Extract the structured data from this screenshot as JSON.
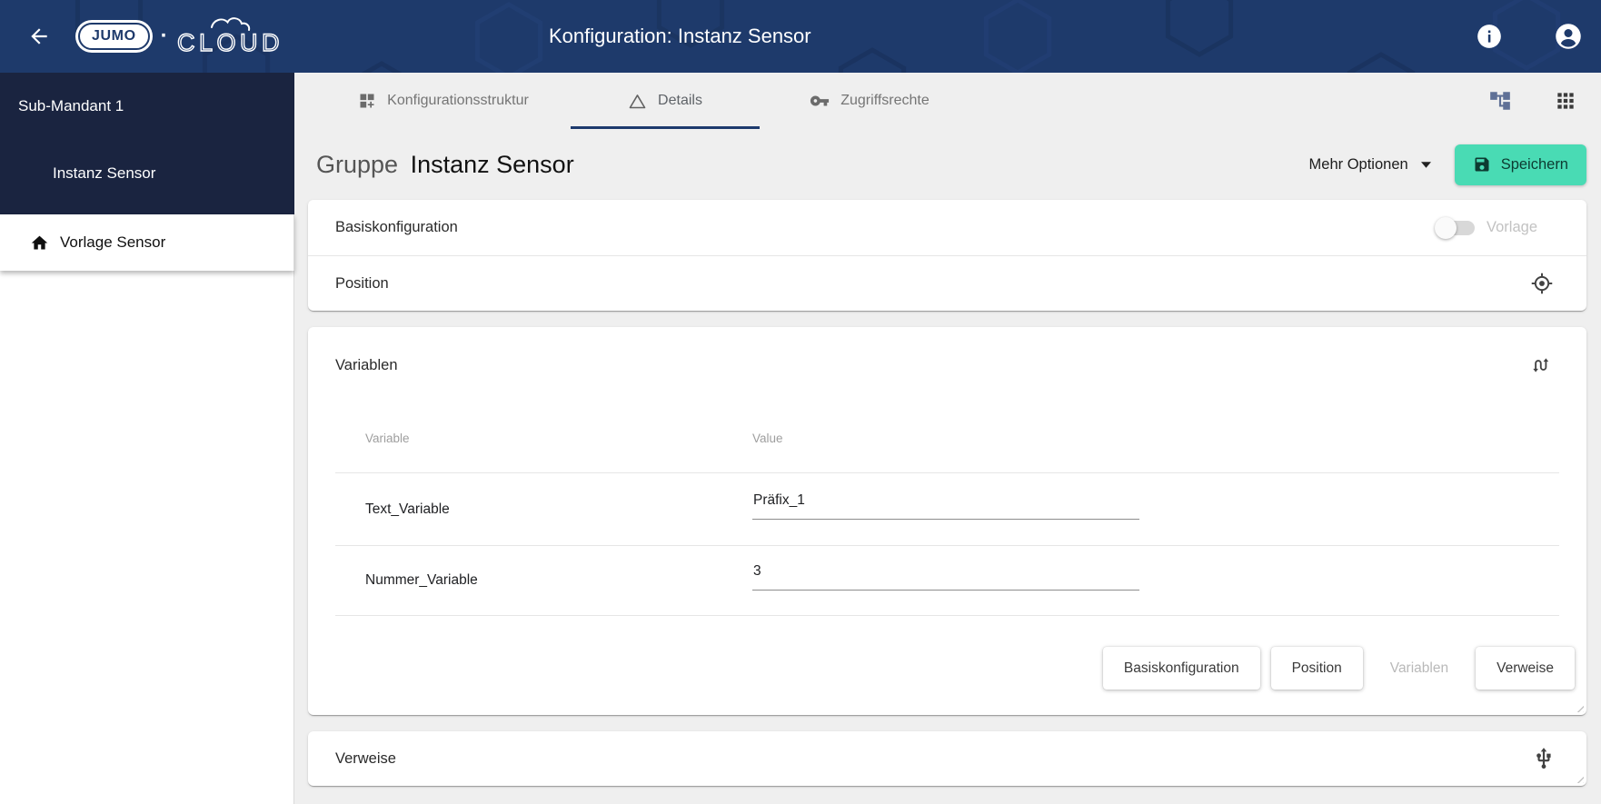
{
  "header": {
    "brand_jumo": "JUMO",
    "brand_dot": "·",
    "brand_cloud": "CLOUD",
    "title": "Konfiguration: Instanz Sensor",
    "icons": [
      "back-arrow-icon",
      "info-icon",
      "account-icon"
    ]
  },
  "sidebar": {
    "tenant": "Sub-Mandant 1",
    "instance_item": "Instanz Sensor",
    "template_item": "Vorlage Sensor",
    "template_icon": "home-icon"
  },
  "tabs": {
    "items": [
      {
        "label": "Konfigurationsstruktur",
        "icon": "dashboard-customize-icon",
        "active": false
      },
      {
        "label": "Details",
        "icon": "details-triangle-icon",
        "active": true
      },
      {
        "label": "Zugriffsrechte",
        "icon": "key-icon",
        "active": false
      }
    ],
    "right_icons": [
      "tree-structure-icon",
      "apps-grid-icon"
    ]
  },
  "toolbar": {
    "heading_prefix": "Gruppe",
    "heading_name": "Instanz Sensor",
    "more_options_label": "Mehr Optionen",
    "save_label": "Speichern",
    "save_icon": "save-icon",
    "caret_icon": "caret-down-icon"
  },
  "sections": {
    "basiskonfiguration": {
      "label": "Basiskonfiguration",
      "toggle_label": "Vorlage",
      "toggle_state": "off"
    },
    "position": {
      "label": "Position",
      "icon": "position-target-icon"
    },
    "variablen": {
      "label": "Variablen",
      "icon": "sort-swap-icon",
      "columns": {
        "variable": "Variable",
        "value": "Value"
      },
      "rows": [
        {
          "variable": "Text_Variable",
          "value": "Präfix_1"
        },
        {
          "variable": "Nummer_Variable",
          "value": "3"
        }
      ],
      "footer_buttons": [
        {
          "label": "Basiskonfiguration",
          "disabled": false
        },
        {
          "label": "Position",
          "disabled": false
        },
        {
          "label": "Variablen",
          "disabled": true
        },
        {
          "label": "Verweise",
          "disabled": false
        }
      ]
    },
    "verweise": {
      "label": "Verweise",
      "icon": "usb-icon"
    }
  },
  "colors": {
    "topbar": "#1e3a6b",
    "sidebar": "#1a2440",
    "accent_save": "#49dbb4",
    "active_tab_underline": "#1d3a6d",
    "page_background": "#efefef"
  }
}
